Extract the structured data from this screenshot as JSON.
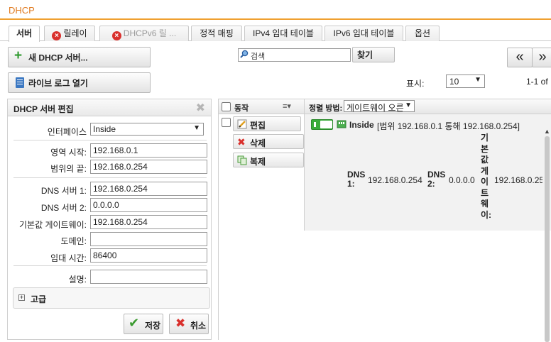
{
  "window": {
    "title": "DHCP"
  },
  "tabs": [
    {
      "label": "서버",
      "active": true
    },
    {
      "label": "릴레이",
      "icon": "error-icon"
    },
    {
      "label": "DHCPv6 릴 ...",
      "icon": "error-icon",
      "disabled": true
    },
    {
      "label": "정적 매핑"
    },
    {
      "label": "IPv4 임대 테이블"
    },
    {
      "label": "IPv6 임대 테이블"
    },
    {
      "label": "옵션"
    }
  ],
  "toolbar": {
    "new_server": "새 DHCP 서버...",
    "live_log": "라이브 로그 열기",
    "search_placeholder": "검색",
    "find": "찾기",
    "show_label": "표시:",
    "page_size": "10",
    "page_info": "1-1 of",
    "first": "«",
    "prev": "»"
  },
  "edit_panel": {
    "title": "DHCP 서버 편집",
    "close": "✖",
    "interface_label": "인터페이스",
    "interface_value": "Inside",
    "range_start_label": "영역 시작:",
    "range_start": "192.168.0.1",
    "range_end_label": "범위의 끝:",
    "range_end": "192.168.0.254",
    "dns1_label": "DNS 서버 1:",
    "dns1": "192.168.0.254",
    "dns2_label": "DNS 서버 2:",
    "dns2": "0.0.0.0",
    "gateway_label": "기본값 게이트웨이:",
    "gateway": "192.168.0.254",
    "domain_label": "도메인:",
    "domain": "",
    "lease_label": "임대 시간:",
    "lease": "86400",
    "desc_label": "설명:",
    "desc": "",
    "advanced": "고급",
    "save": "저장",
    "cancel": "취소"
  },
  "grid": {
    "col_action": "동작",
    "sort_label": "정렬 방법:",
    "sort_value": "게이트웨이 오른",
    "actions": {
      "edit": "편집",
      "delete": "삭제",
      "copy": "복제"
    },
    "row": {
      "name": "Inside",
      "range": "[범위 192.168.0.1 통해 192.168.0.254]",
      "dns1_label": "DNS 1:",
      "dns1": "192.168.0.254",
      "dns2_label": "DNS 2:",
      "dns2": "0.0.0.0",
      "gateway_label": "기본값 게이트웨이:",
      "gateway": "192.168.0.25",
      "enabled": true
    }
  },
  "colors": {
    "accent": "#e07a1f",
    "enabled": "#3bab3b",
    "error": "#d9302c"
  }
}
